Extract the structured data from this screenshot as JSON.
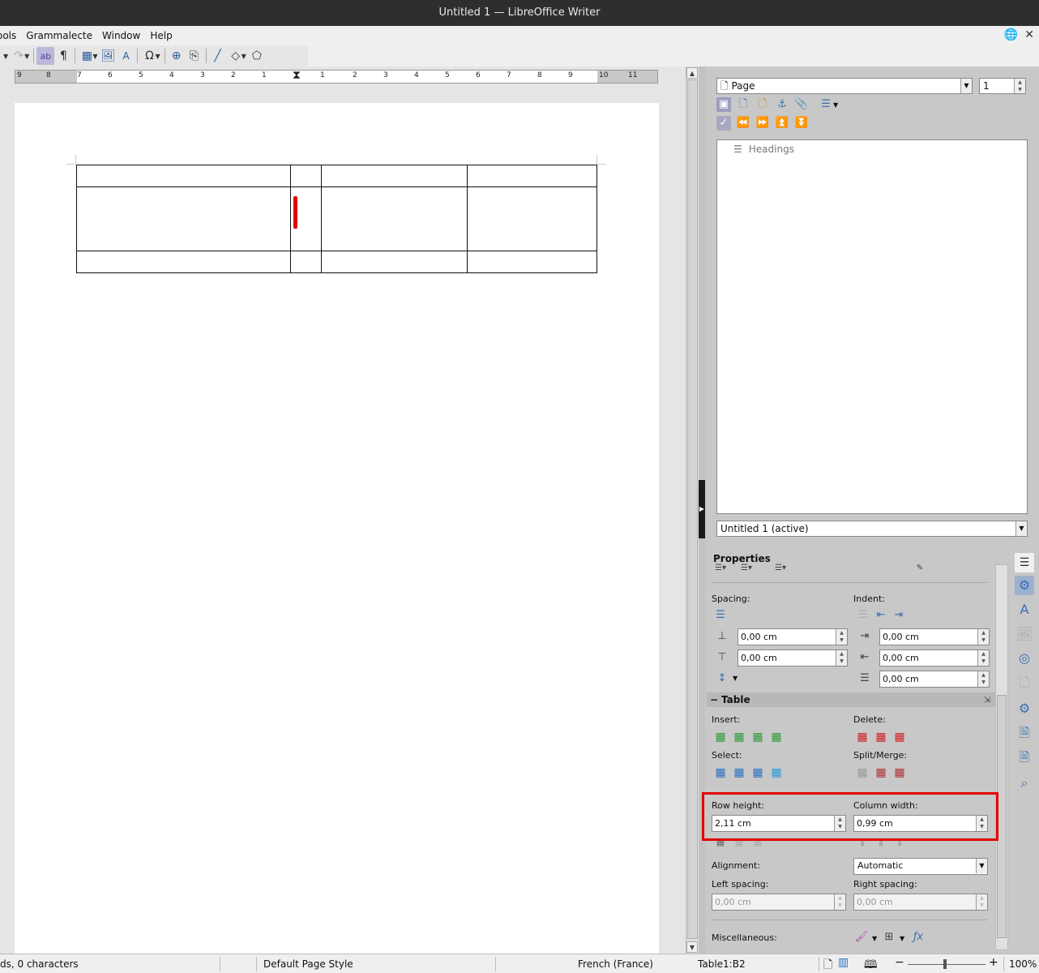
{
  "window": {
    "title": "Untitled 1 — LibreOffice Writer"
  },
  "menu": {
    "items": [
      "ools",
      "Grammalecte",
      "Window",
      "Help"
    ]
  },
  "ruler": {
    "numbers": [
      "9",
      "8",
      "7",
      "6",
      "5",
      "4",
      "3",
      "2",
      "1",
      "1",
      "2",
      "3",
      "4",
      "5",
      "6",
      "7",
      "8",
      "9",
      "10",
      "11"
    ]
  },
  "navigator": {
    "category": "Page",
    "page_number": "1",
    "tree_item": "Headings",
    "document": "Untitled 1 (active)"
  },
  "properties": {
    "title": "Properties",
    "spacing_label": "Spacing:",
    "indent_label": "Indent:",
    "spacing_above": "0,00 cm",
    "spacing_below": "0,00 cm",
    "indent_before": "0,00 cm",
    "indent_after": "0,00 cm",
    "indent_first": "0,00 cm",
    "table_section": "Table",
    "insert_label": "Insert:",
    "delete_label": "Delete:",
    "select_label": "Select:",
    "split_merge_label": "Split/Merge:",
    "row_height_label": "Row height:",
    "row_height": "2,11 cm",
    "column_width_label": "Column width:",
    "column_width": "0,99 cm",
    "alignment_label": "Alignment:",
    "alignment": "Automatic",
    "left_spacing_label": "Left spacing:",
    "left_spacing": "0,00 cm",
    "right_spacing_label": "Right spacing:",
    "right_spacing": "0,00 cm",
    "misc_label": "Miscellaneous:"
  },
  "status": {
    "words": "ds, 0 characters",
    "page_style": "Default Page Style",
    "language": "French (France)",
    "cell": "Table1:B2",
    "zoom": "100%"
  }
}
